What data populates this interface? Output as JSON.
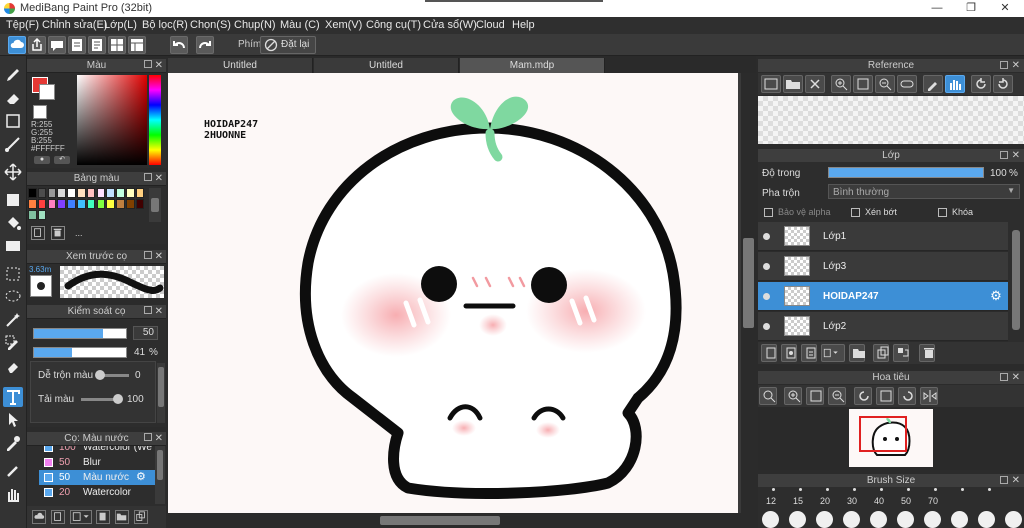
{
  "window": {
    "title": "MediBang Paint Pro (32bit)"
  },
  "menu": [
    "Tệp(F)",
    "Chỉnh sửa(E)",
    "Lớp(L)",
    "Bộ lọc(R)",
    "Chọn(S)",
    "Chụp(N)",
    "Màu (C)",
    "Xem(V)",
    "Công cụ(T)",
    "Cửa sổ(W)",
    "Cloud",
    "Help"
  ],
  "toolbar": {
    "shortcut_label": "Phím",
    "undo_text": "Đặt lại"
  },
  "color_panel": {
    "title": "Màu",
    "r_label": "R:255",
    "g_label": "G:255",
    "b_label": "B:255",
    "hex": "#FFFFFF"
  },
  "palette_panel": {
    "title": "Bảng màu",
    "more": "...",
    "swatches": [
      "#000000",
      "#4d4d4d",
      "#999999",
      "#d9d9d9",
      "#ffffff",
      "#ffe0c0",
      "#ffc0c0",
      "#ffe0ff",
      "#c0e0ff",
      "#c0ffe0",
      "#ffffc0",
      "#ffd080",
      "#ff8040",
      "#ff4040",
      "#ff80c0",
      "#8040ff",
      "#4080ff",
      "#40c0ff",
      "#40ffc0",
      "#80ff40",
      "#ffff40",
      "#c08040",
      "#804000",
      "#400000",
      "#80c0a0",
      "#a0e0c0"
    ]
  },
  "brush_preview": {
    "title": "Xem trước cọ",
    "size_label": "3.63m"
  },
  "brush_control": {
    "title": "Kiểm soát cọ",
    "size_value": "50",
    "opacity_value": "41",
    "opacity_unit": "%",
    "opacity_level": 0.41,
    "blend_label": "Dễ trộn màu",
    "blend_value": "0",
    "amount_label": "Tải màu",
    "amount_value": "100"
  },
  "brush_list": {
    "title": "Cọ: Màu nước",
    "items": [
      {
        "size": "100",
        "name": "Watercolor (We"
      },
      {
        "size": "50",
        "name": "Blur"
      },
      {
        "size": "50",
        "name": "Màu nước"
      },
      {
        "size": "20",
        "name": "Watercolor"
      }
    ]
  },
  "tabs": [
    "Untitled",
    "Untitled",
    "Mam.mdp"
  ],
  "canvas": {
    "text_line1": "HOIDAP247",
    "text_line2": "2HUONNE"
  },
  "reference_panel": {
    "title": "Reference"
  },
  "layer_panel": {
    "title": "Lớp",
    "opacity_label": "Độ trong",
    "opacity_value": "100",
    "opacity_unit": "%",
    "opacity_level": 1.0,
    "blend_label": "Pha trộn",
    "blend_value": "Bình thường",
    "protect_alpha": "Bảo vệ alpha",
    "clipping": "Xén bớt",
    "lock": "Khóa",
    "layers": [
      {
        "name": "Lớp1",
        "selected": false
      },
      {
        "name": "Lớp3",
        "selected": false
      },
      {
        "name": "HOIDAP247",
        "selected": true
      },
      {
        "name": "Lớp2",
        "selected": false
      }
    ]
  },
  "navigator_panel": {
    "title": "Hoa tiêu"
  },
  "brush_size_panel": {
    "title": "Brush Size",
    "sizes": [
      "12",
      "15",
      "20",
      "30",
      "40",
      "50",
      "70"
    ]
  },
  "colors": {
    "accent": "#3d8fd6",
    "canvas_bg": "#fdf8f7",
    "sprout": "#7fd8a0",
    "blush": "#f7b9bd"
  }
}
